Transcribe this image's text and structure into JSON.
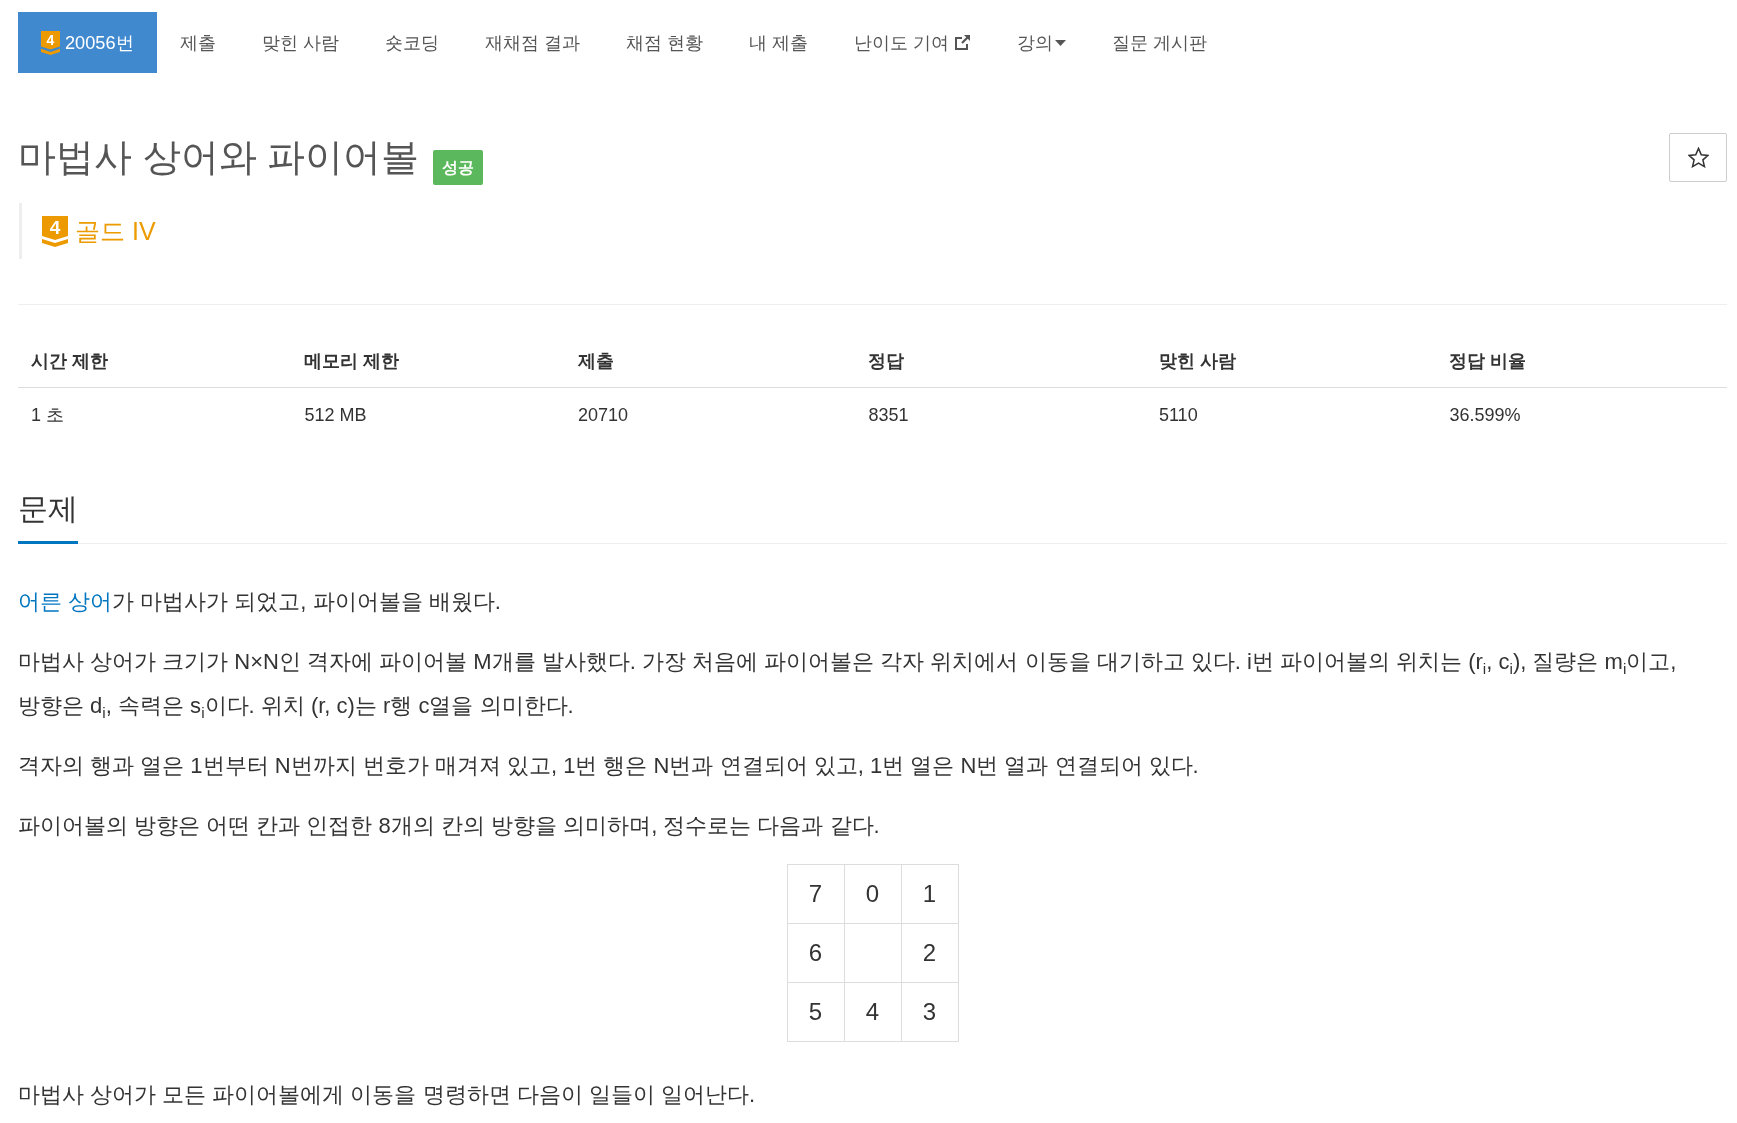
{
  "nav": {
    "tabs": [
      {
        "label": "20056번",
        "badge": "4",
        "kind": "link",
        "selected": true
      },
      {
        "label": "제출",
        "kind": "link",
        "selected": false
      },
      {
        "label": "맞힌 사람",
        "kind": "link",
        "selected": false
      },
      {
        "label": "숏코딩",
        "kind": "link",
        "selected": false
      },
      {
        "label": "재채점 결과",
        "kind": "link",
        "selected": false
      },
      {
        "label": "채점 현황",
        "kind": "link",
        "selected": false
      },
      {
        "label": "내 제출",
        "kind": "link",
        "selected": false
      },
      {
        "label": "난이도 기여",
        "kind": "external",
        "selected": false
      },
      {
        "label": "강의",
        "kind": "dropdown",
        "selected": false
      },
      {
        "label": "질문 게시판",
        "kind": "link",
        "selected": false
      }
    ]
  },
  "problem": {
    "title": "마법사 상어와 파이어볼",
    "status_badge": "성공",
    "favorite": {
      "on": false
    },
    "tier": {
      "badge": "4",
      "label": "골드 IV"
    }
  },
  "info_table": {
    "columns": [
      "시간 제한",
      "메모리 제한",
      "제출",
      "정답",
      "맞힌 사람",
      "정답 비율"
    ],
    "rows": [
      [
        "1 초",
        "512 MB",
        "20710",
        "8351",
        "5110",
        "36.599%"
      ]
    ]
  },
  "statement": {
    "heading": "문제",
    "blocks": [
      {
        "kind": "paragraph",
        "link": "어른 상어",
        "text": "가 마법사가 되었고, 파이어볼을 배웠다."
      },
      {
        "kind": "paragraph",
        "text": "마법사 상어가 크기가 N×N인 격자에 파이어볼 M개를 발사했다. 가장 처음에 파이어볼은 각자 위치에서 이동을 대기하고 있다. i번 파이어볼의 위치는 (r$_{i}$, c$_{i}$), 질량은 m$_{i}$이고, 방향은 d$_{i}$, 속력은 s$_{i}$이다. 위치 (r, c)는 r행 c열을 의미한다."
      },
      {
        "kind": "paragraph",
        "text": "격자의 행과 열은 1번부터 N번까지 번호가 매겨져 있고, 1번 행은 N번과 연결되어 있고, 1번 열은 N번 열과 연결되어 있다."
      },
      {
        "kind": "paragraph",
        "text": "파이어볼의 방향은 어떤 칸과 인접한 8개의 칸의 방향을 의미하며, 정수로는 다음과 같다."
      },
      {
        "kind": "grid",
        "rows": [
          [
            "7",
            "0",
            "1"
          ],
          [
            "6",
            null,
            "2"
          ],
          [
            "5",
            "4",
            "3"
          ]
        ]
      },
      {
        "kind": "paragraph",
        "text": "마법사 상어가 모든 파이어볼에게 이동을 명령하면 다음이 일들이 일어난다."
      }
    ]
  }
}
